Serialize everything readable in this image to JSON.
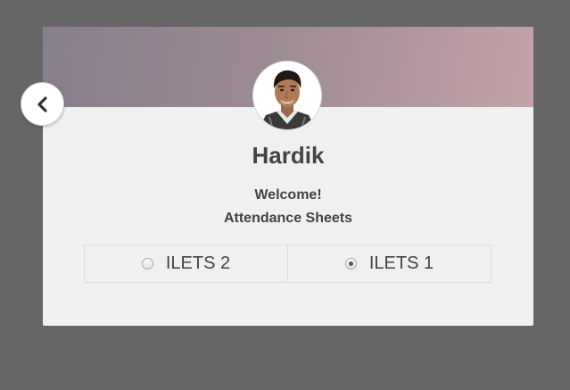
{
  "profile": {
    "name": "Hardik",
    "avatar_icon": "user-photo"
  },
  "welcome_text": "Welcome!",
  "subtitle": "Attendance Sheets",
  "options": [
    {
      "label": "ILETS 2",
      "checked": false
    },
    {
      "label": "ILETS 1",
      "checked": true
    }
  ],
  "nav": {
    "back_icon": "chevron-left-icon"
  },
  "colors": {
    "background": "#666666",
    "card": "#f0f0f0",
    "header_gradient_start": "#877f8c",
    "header_gradient_end": "#c3a3a8",
    "text": "#444444"
  }
}
